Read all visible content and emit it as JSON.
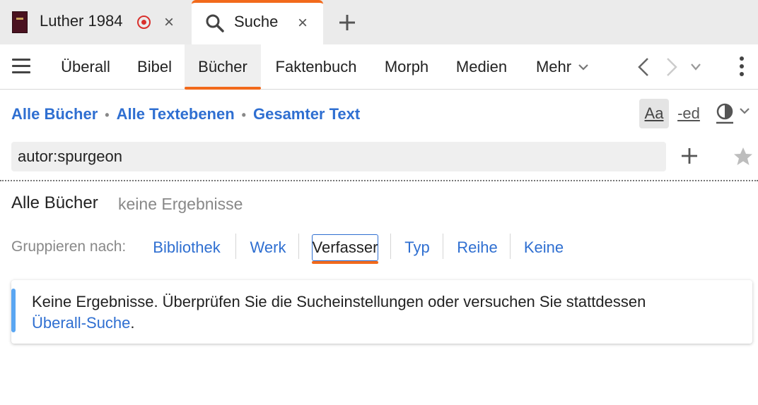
{
  "tabs": [
    {
      "title": "Luther 1984",
      "icon": "book-thumbnail"
    },
    {
      "title": "Suche",
      "icon": "search-icon",
      "active": true
    }
  ],
  "nav": {
    "items": [
      "Überall",
      "Bibel",
      "Bücher",
      "Faktenbuch",
      "Morph",
      "Medien",
      "Mehr"
    ],
    "active": "Bücher"
  },
  "breadcrumb": {
    "scope": "Alle Bücher",
    "level": "Alle Textebenen",
    "range": "Gesamter Text"
  },
  "controls": {
    "case_label": "Aa",
    "ed_label": "-ed"
  },
  "search": {
    "value": "autor:spurgeon"
  },
  "results": {
    "title": "Alle Bücher",
    "count": "keine Ergebnisse"
  },
  "groupby": {
    "label": "Gruppieren nach:",
    "options": [
      "Bibliothek",
      "Werk",
      "Verfasser",
      "Typ",
      "Reihe",
      "Keine"
    ],
    "selected": "Verfasser"
  },
  "message": {
    "text": "Keine Ergebnisse. Überprüfen Sie die Sucheinstellungen oder versuchen Sie stattdessen",
    "link": "Überall-Suche",
    "suffix": "."
  },
  "colors": {
    "accent": "#f26a1b",
    "link": "#2f6fd1",
    "target": "#d9302c",
    "info_bar": "#5aa6f2"
  }
}
